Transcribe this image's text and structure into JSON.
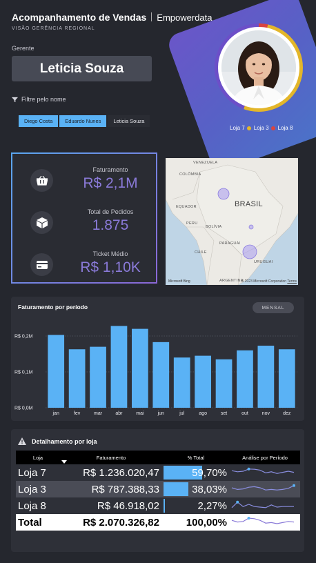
{
  "header": {
    "title": "Acompanhamento de Vendas",
    "brand": "Empowerdata",
    "subtitle": "VISÃO GERÊNCIA REGIONAL"
  },
  "manager": {
    "label": "Gerente",
    "name": "Leticia Souza"
  },
  "filter": {
    "label": "Filtre pelo nome",
    "options": [
      {
        "label": "Diego Costa",
        "selected": true
      },
      {
        "label": "Eduardo Nunes",
        "selected": true
      },
      {
        "label": "Leticia Souza",
        "selected": false
      }
    ]
  },
  "stores_legend": [
    {
      "label": "Loja 7",
      "color": "#6c4fc8"
    },
    {
      "label": "Loja 3",
      "color": "#e3b62a"
    },
    {
      "label": "Loja 8",
      "color": "#d9443f"
    }
  ],
  "kpis": [
    {
      "label": "Faturamento",
      "value": "R$ 2,1M",
      "icon": "basket-icon"
    },
    {
      "label": "Total de Pedidos",
      "value": "1.875",
      "icon": "box-icon"
    },
    {
      "label": "Ticket Médio",
      "value": "R$ 1,10K",
      "icon": "card-icon"
    }
  ],
  "map": {
    "labels": [
      "VENEZUELA",
      "COLÔMBIA",
      "EQUADOR",
      "PERU",
      "BRASIL",
      "BOLÍVIA",
      "PARAGUAI",
      "CHILE",
      "URUGUAI",
      "ARGENTINA"
    ],
    "copyright": "© 2023 Microsoft Corporation",
    "terms": "Terms",
    "logo": "Microsoft Bing"
  },
  "period_chart_title": "Faturamento por período",
  "period_toggle": "MENSAL",
  "chart_data": {
    "type": "bar",
    "title": "Faturamento por período",
    "categories": [
      "jan",
      "fev",
      "mar",
      "abr",
      "mai",
      "jun",
      "jul",
      "ago",
      "set",
      "out",
      "nov",
      "dez"
    ],
    "values": [
      0.203,
      0.163,
      0.17,
      0.228,
      0.22,
      0.183,
      0.14,
      0.145,
      0.135,
      0.16,
      0.173,
      0.163
    ],
    "yticks": [
      "R$ 0,0M",
      "R$ 0,1M",
      "R$ 0,2M"
    ],
    "ylim": [
      0,
      0.2
    ],
    "ylabel": "",
    "xlabel": "",
    "color": "#5ab2f5",
    "grid": true
  },
  "table": {
    "title": "Detalhamento por loja",
    "headers": [
      "Loja",
      "Faturamento",
      "% Total",
      "Análise por Período"
    ],
    "rows": [
      {
        "loja": "Loja 7",
        "faturamento": "R$ 1.236.020,47",
        "pct": "59,70%",
        "share": 0.597,
        "trend": [
          0.55,
          0.45,
          0.5,
          0.7,
          0.68,
          0.6,
          0.35,
          0.45,
          0.3,
          0.4,
          0.5,
          0.4
        ]
      },
      {
        "loja": "Loja 3",
        "faturamento": "R$ 787.388,33",
        "pct": "38,03%",
        "share": 0.3803,
        "trend": [
          0.5,
          0.35,
          0.4,
          0.55,
          0.6,
          0.5,
          0.3,
          0.35,
          0.3,
          0.35,
          0.45,
          0.7
        ]
      },
      {
        "loja": "Loja 8",
        "faturamento": "R$ 46.918,02",
        "pct": "2,27%",
        "share": 0.0227,
        "trend": [
          0.2,
          0.7,
          0.3,
          0.5,
          0.3,
          0.25,
          0.2,
          0.45,
          0.25,
          0.3,
          0.3,
          0.3
        ]
      }
    ],
    "total": {
      "loja": "Total",
      "faturamento": "R$ 2.070.326,82",
      "pct": "100,00%",
      "trend": [
        0.55,
        0.4,
        0.45,
        0.75,
        0.7,
        0.55,
        0.3,
        0.35,
        0.25,
        0.35,
        0.45,
        0.4
      ]
    }
  }
}
